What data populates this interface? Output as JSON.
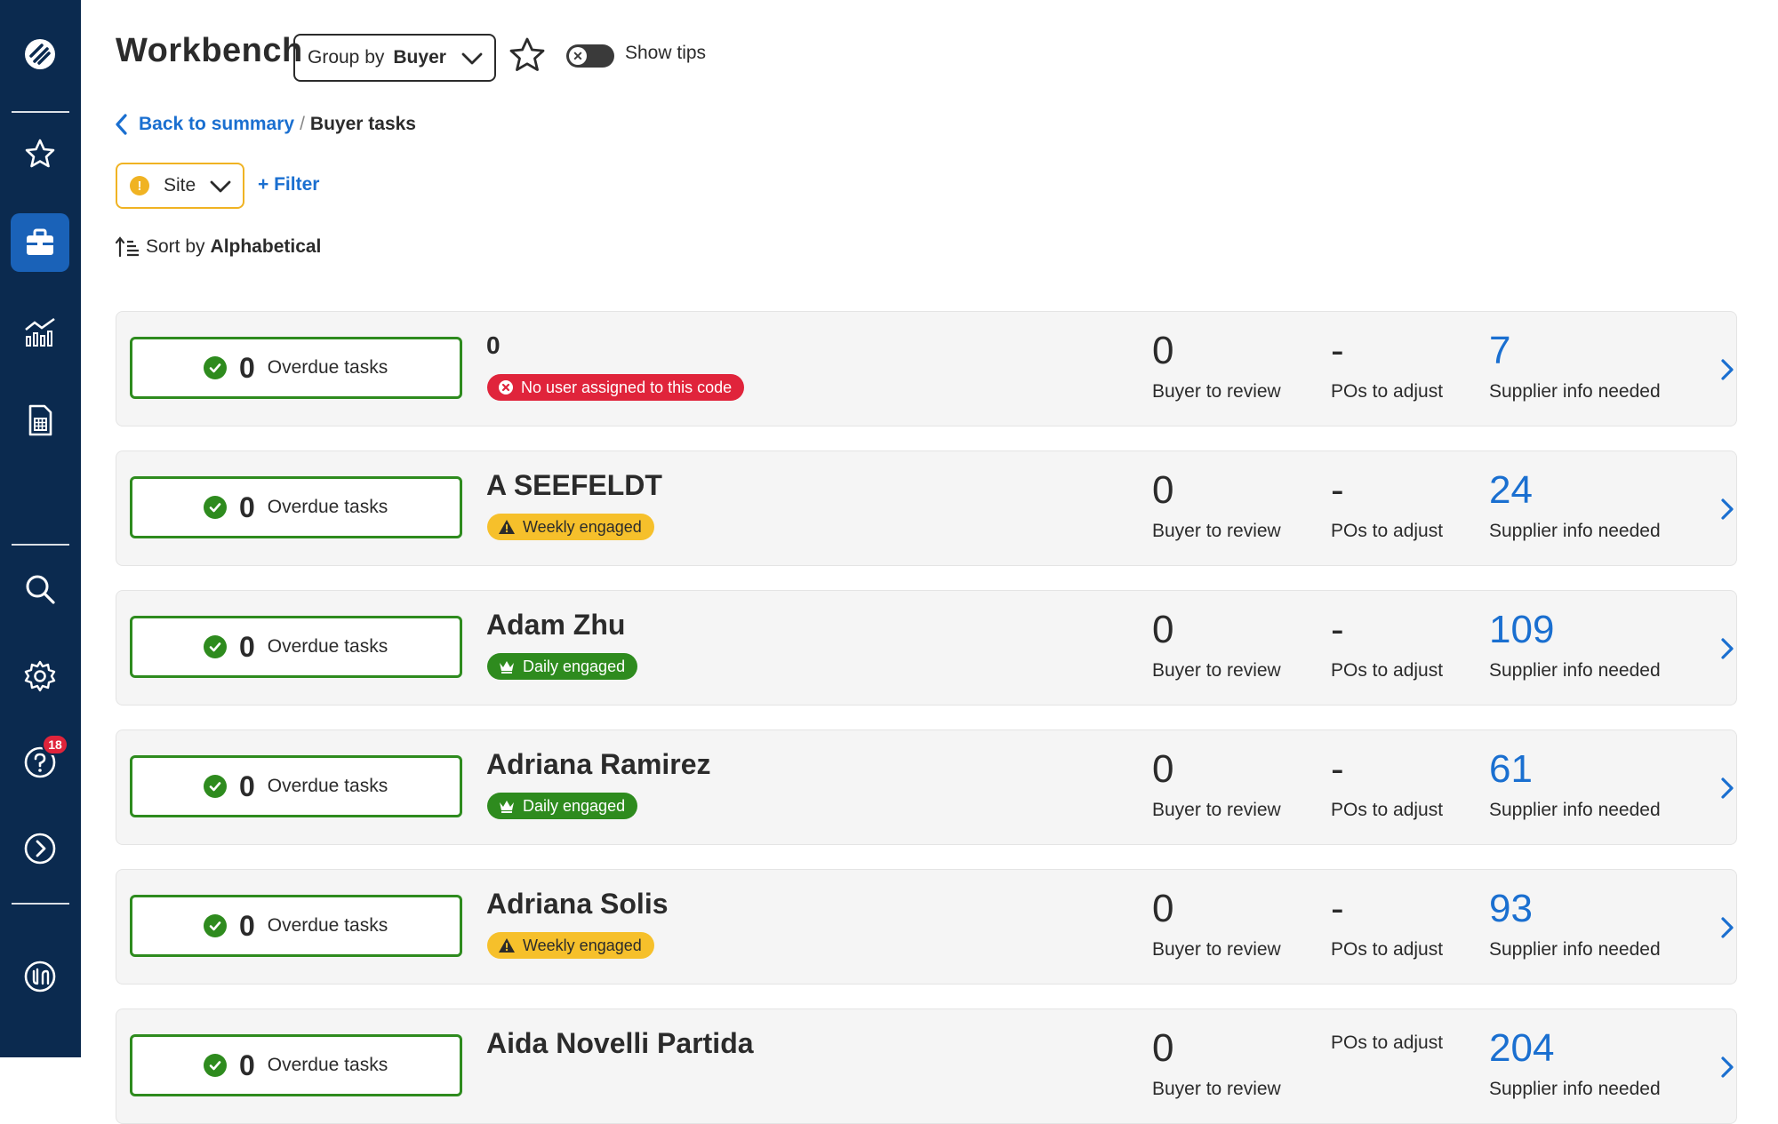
{
  "header": {
    "title": "Workbench",
    "group_by_label": "Group by",
    "group_by_value": "Buyer",
    "tips_label": "Show tips"
  },
  "breadcrumb": {
    "back": "Back to summary",
    "separator": "/",
    "current": "Buyer tasks"
  },
  "filters": {
    "site_label": "Site",
    "filter_label": "+ Filter"
  },
  "sort": {
    "label": "Sort by",
    "value": "Alphabetical"
  },
  "sidebar": {
    "help_badge": "18"
  },
  "metric_labels": {
    "buyer_review": "Buyer to review",
    "pos_adjust": "POs to adjust",
    "supplier_info": "Supplier info needed",
    "overdue": "Overdue tasks"
  },
  "rows": [
    {
      "name": "0",
      "tag": "No user assigned to this code",
      "tag_type": "red",
      "overdue": "0",
      "buyer_review": "0",
      "pos_adjust": "-",
      "supplier_info": "7"
    },
    {
      "name": "A SEEFELDT",
      "tag": "Weekly engaged",
      "tag_type": "yellow",
      "overdue": "0",
      "buyer_review": "0",
      "pos_adjust": "-",
      "supplier_info": "24"
    },
    {
      "name": "Adam Zhu",
      "tag": "Daily engaged",
      "tag_type": "green",
      "overdue": "0",
      "buyer_review": "0",
      "pos_adjust": "-",
      "supplier_info": "109"
    },
    {
      "name": "Adriana Ramirez",
      "tag": "Daily engaged",
      "tag_type": "green",
      "overdue": "0",
      "buyer_review": "0",
      "pos_adjust": "-",
      "supplier_info": "61"
    },
    {
      "name": "Adriana Solis",
      "tag": "Weekly engaged",
      "tag_type": "yellow",
      "overdue": "0",
      "buyer_review": "0",
      "pos_adjust": "-",
      "supplier_info": "93"
    },
    {
      "name": "Aida Novelli Partida",
      "tag": "",
      "tag_type": "",
      "overdue": "0",
      "buyer_review": "0",
      "pos_adjust": "",
      "supplier_info": "204"
    }
  ],
  "colors": {
    "sidebar_bg": "#0b2a4f",
    "accent_blue": "#1a6fd0",
    "success_green": "#2e8b1e",
    "warning_yellow": "#f6c02b",
    "error_red": "#e0243b"
  }
}
